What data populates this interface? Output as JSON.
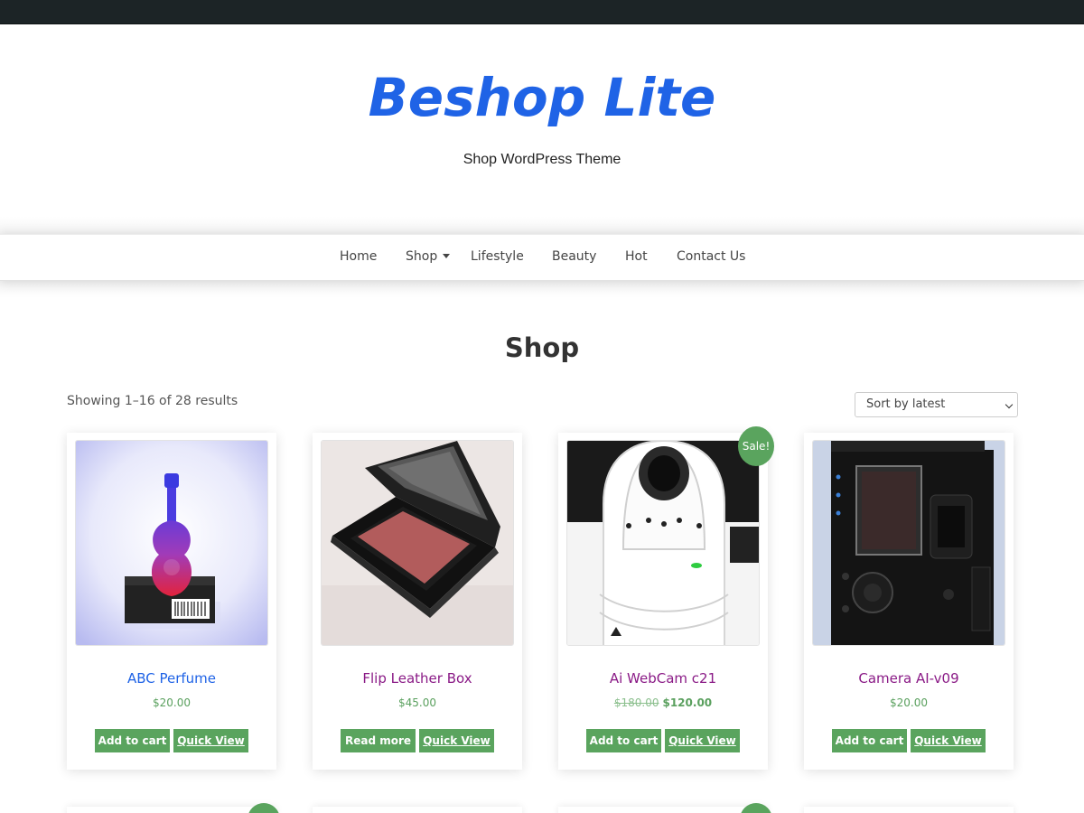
{
  "site": {
    "title": "Beshop Lite",
    "tagline": "Shop WordPress Theme"
  },
  "nav": {
    "items": [
      {
        "label": "Home"
      },
      {
        "label": "Shop",
        "has_submenu": true
      },
      {
        "label": "Lifestyle"
      },
      {
        "label": "Beauty"
      },
      {
        "label": "Hot"
      },
      {
        "label": "Contact Us"
      }
    ]
  },
  "page": {
    "title": "Shop",
    "result_count": "Showing 1–16 of 28 results",
    "sort": {
      "selected": "Sort by latest"
    }
  },
  "products": [
    {
      "name": "ABC Perfume",
      "price": "$20.00",
      "primary_button": "Add to cart",
      "secondary_button": "Quick View",
      "sale": false
    },
    {
      "name": "Flip Leather Box",
      "price": "$45.00",
      "primary_button": "Read more",
      "secondary_button": "Quick View",
      "sale": false
    },
    {
      "name": "Ai WebCam c21",
      "old_price": "$180.00",
      "price": "$120.00",
      "primary_button": "Add to cart",
      "secondary_button": "Quick View",
      "sale": true,
      "badge": "Sale!"
    },
    {
      "name": "Camera AI-v09",
      "price": "$20.00",
      "primary_button": "Add to cart",
      "secondary_button": "Quick View",
      "sale": false
    }
  ],
  "colors": {
    "brand_blue": "#1f63e6",
    "product_title": "#8a1a86",
    "accent_green": "#5aa45e",
    "topbar": "#1c2426"
  }
}
